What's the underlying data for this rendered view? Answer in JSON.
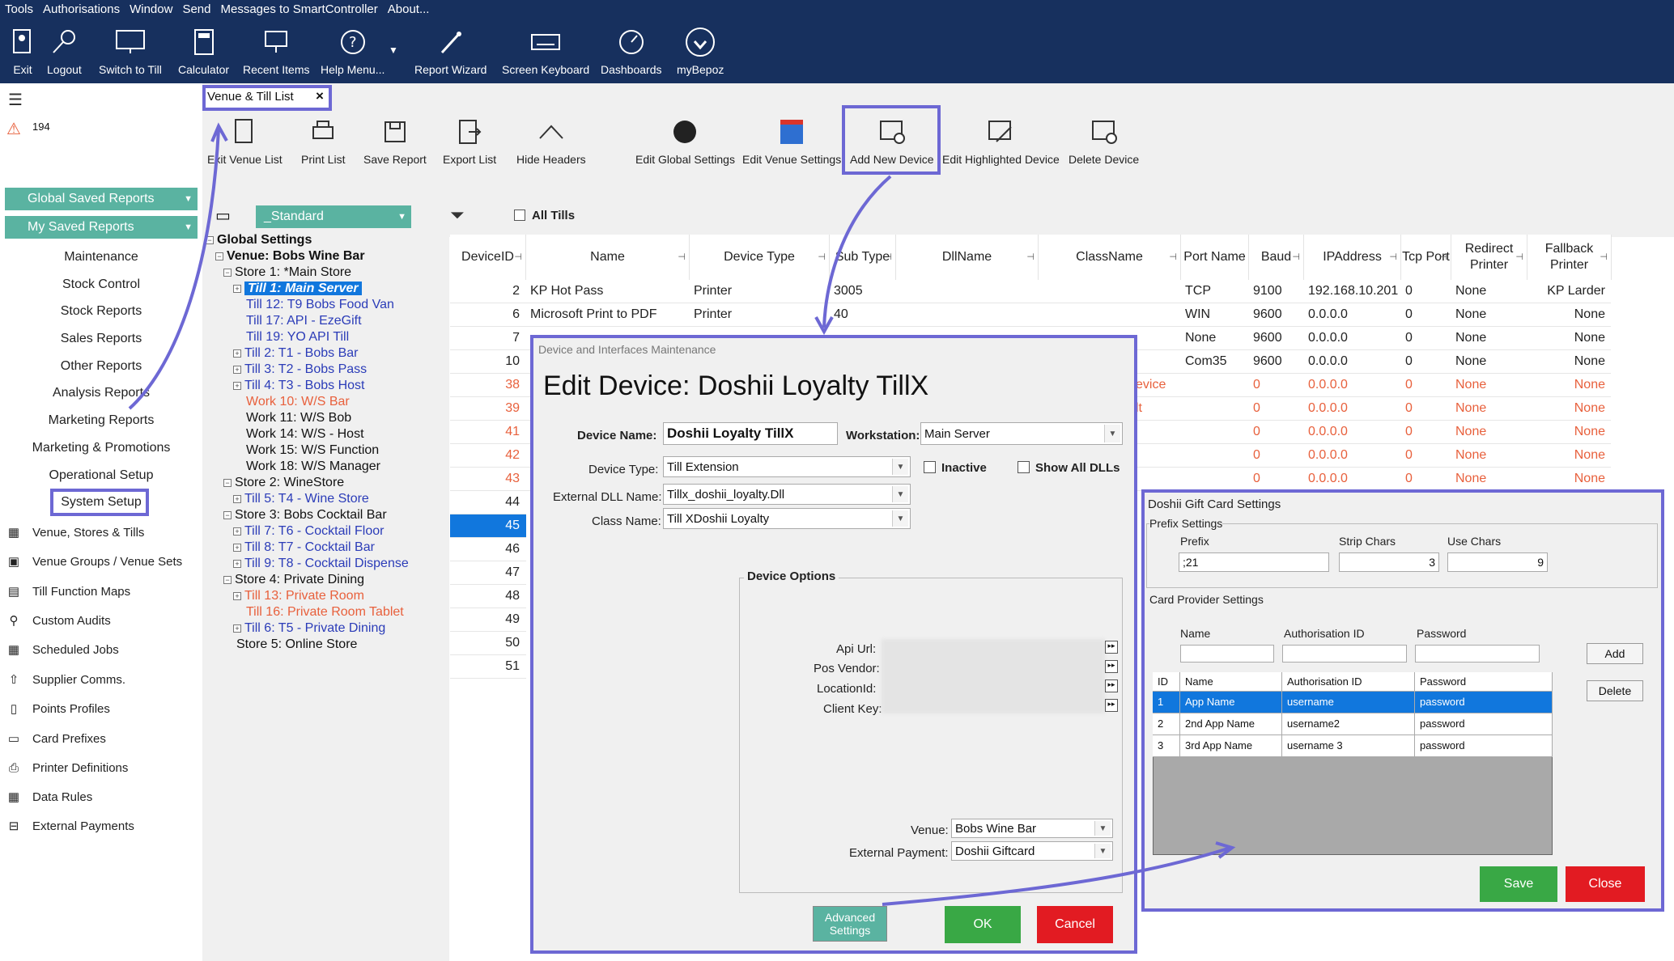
{
  "menu": [
    "Tools",
    "Authorisations",
    "Window",
    "Send",
    "Messages to SmartController",
    "About..."
  ],
  "toolbar": [
    "Exit",
    "Logout",
    "Switch to Till",
    "Calculator",
    "Recent Items",
    "Help Menu...",
    "Report Wizard",
    "Screen Keyboard",
    "Dashboards",
    "myBepoz"
  ],
  "alerts": {
    "count": "194"
  },
  "sidebar": {
    "global_reports": "Global Saved Reports",
    "my_reports": "My Saved Reports",
    "items": [
      "Maintenance",
      "Stock Control",
      "Stock Reports",
      "Sales Reports",
      "Other Reports",
      "Analysis Reports",
      "Marketing Reports",
      "Marketing & Promotions",
      "Operational Setup",
      "System Setup"
    ],
    "icon_items": [
      "Venue, Stores & Tills",
      "Venue Groups / Venue Sets",
      "Till Function Maps",
      "Custom Audits",
      "Scheduled Jobs",
      "Supplier Comms.",
      "Points Profiles",
      "Card Prefixes",
      "Printer Definitions",
      "Data Rules",
      "External Payments"
    ]
  },
  "tab": {
    "label": "Venue & Till List",
    "close": "×"
  },
  "actions": [
    "Exit Venue List",
    "Print List",
    "Save Report",
    "Export List",
    "Hide Headers",
    "Edit Global Settings",
    "Edit Venue Settings",
    "Add New Device",
    "Edit Highlighted Device",
    "Delete Device"
  ],
  "view_select": "_Standard",
  "all_tills": "All Tills",
  "tree": [
    "Global Settings",
    "Venue: Bobs Wine Bar",
    "Store 1: *Main Store",
    "Till 1: Main Server",
    "Till 12: T9 Bobs Food Van",
    "Till 17: API - EzeGift",
    "Till 19: YO API Till",
    "Till 2: T1 - Bobs Bar",
    "Till 3: T2 - Bobs Pass",
    "Till 4: T3 - Bobs Host",
    "Work 10: W/S Bar",
    "Work 11: W/S Bob",
    "Work 14: W/S - Host",
    "Work 15: W/S Function",
    "Work 18: W/S Manager",
    "Store 2: WineStore",
    "Till 5: T4 - Wine Store",
    "Store 3: Bobs Cocktail Bar",
    "Till 7: T6 - Cocktail Floor",
    "Till 8: T7 - Cocktail Bar",
    "Till 9: T8 - Cocktail Dispense",
    "Store 4: Private Dining",
    "Till 13: Private Room",
    "Till 16: Private Room Tablet",
    "Till 6: T5 - Private Dining",
    "Store 5: Online Store"
  ],
  "grid": {
    "headers": [
      "DeviceID",
      "Name",
      "Device Type",
      "Sub Type",
      "DllName",
      "ClassName",
      "Port Name",
      "Baud",
      "IPAddress",
      "Tcp Port",
      "Redirect Printer",
      "Fallback Printer"
    ],
    "rows": [
      [
        "2",
        "KP Hot Pass",
        "Printer",
        "3005",
        "",
        "",
        "TCP",
        "9100",
        "192.168.10.201",
        "0",
        "None",
        "KP Larder"
      ],
      [
        "6",
        "Microsoft Print to PDF",
        "Printer",
        "40",
        "",
        "",
        "WIN",
        "9600",
        "0.0.0.0",
        "0",
        "None",
        "None"
      ],
      [
        "7",
        "",
        "",
        "",
        "",
        "",
        "None",
        "9600",
        "0.0.0.0",
        "0",
        "None",
        "None"
      ],
      [
        "10",
        "",
        "",
        "",
        "",
        "",
        "Com35",
        "9600",
        "0.0.0.0",
        "0",
        "None",
        "None"
      ],
      [
        "38",
        "",
        "",
        "",
        "",
        "evice",
        "",
        "0",
        "0.0.0.0",
        "0",
        "None",
        "None"
      ],
      [
        "39",
        "",
        "",
        "",
        "",
        "lt",
        "",
        "0",
        "0.0.0.0",
        "0",
        "None",
        "None"
      ],
      [
        "41",
        "",
        "",
        "",
        "",
        "",
        "",
        "0",
        "0.0.0.0",
        "0",
        "None",
        "None"
      ],
      [
        "42",
        "",
        "",
        "",
        "",
        "",
        "",
        "0",
        "0.0.0.0",
        "0",
        "None",
        "None"
      ],
      [
        "43",
        "",
        "",
        "",
        "",
        "",
        "",
        "0",
        "0.0.0.0",
        "0",
        "None",
        "None"
      ],
      [
        "44",
        "",
        "",
        "",
        "",
        "",
        "",
        "",
        "",
        "",
        "",
        ""
      ],
      [
        "45",
        "",
        "",
        "",
        "",
        "",
        "",
        "",
        "",
        "",
        "",
        ""
      ],
      [
        "46",
        "",
        "",
        "",
        "",
        "",
        "",
        "",
        "",
        "",
        "",
        ""
      ],
      [
        "47",
        "",
        "",
        "",
        "",
        "",
        "",
        "",
        "",
        "",
        "",
        ""
      ],
      [
        "48",
        "",
        "",
        "",
        "",
        "",
        "",
        "",
        "",
        "",
        "",
        ""
      ],
      [
        "49",
        "",
        "",
        "",
        "",
        "",
        "",
        "",
        "",
        "",
        "",
        ""
      ],
      [
        "50",
        "",
        "",
        "",
        "",
        "",
        "",
        "",
        "",
        "",
        "",
        ""
      ],
      [
        "51",
        "",
        "",
        "",
        "",
        "",
        "",
        "",
        "",
        "",
        "",
        ""
      ]
    ]
  },
  "edit_dialog": {
    "window_title": "Device and Interfaces Maintenance",
    "title": "Edit Device: Doshii Loyalty TillX",
    "device_name_label": "Device Name:",
    "device_name": "Doshii Loyalty TillX",
    "workstation_label": "Workstation:",
    "workstation": "Main Server",
    "device_type_label": "Device Type:",
    "device_type": "Till Extension",
    "inactive": "Inactive",
    "show_all_dlls": "Show All DLLs",
    "ext_dll_label": "External DLL Name:",
    "ext_dll": "Tillx_doshii_loyalty.Dll",
    "class_label": "Class Name:",
    "class_name": "Till XDoshii Loyalty",
    "options_title": "Device Options",
    "options": [
      "Api Url:",
      "Pos Vendor:",
      "LocationId:",
      "Client Key:"
    ],
    "venue_label": "Venue:",
    "venue": "Bobs Wine Bar",
    "ext_payment_label": "External Payment:",
    "ext_payment": "Doshii Giftcard",
    "advanced": "Advanced Settings",
    "ok": "OK",
    "cancel": "Cancel"
  },
  "gift_dialog": {
    "title": "Doshii Gift Card Settings",
    "prefix_settings": "Prefix Settings",
    "prefix_label": "Prefix",
    "prefix": ";21",
    "strip_label": "Strip Chars",
    "strip": "3",
    "use_label": "Use Chars",
    "use": "9",
    "provider_settings": "Card Provider Settings",
    "name_label": "Name",
    "auth_label": "Authorisation ID",
    "password_label": "Password",
    "add": "Add",
    "delete": "Delete",
    "table_headers": [
      "ID",
      "Name",
      "Authorisation ID",
      "Password"
    ],
    "rows": [
      [
        "1",
        "App Name",
        "username",
        "password"
      ],
      [
        "2",
        "2nd App Name",
        "username2",
        "password"
      ],
      [
        "3",
        "3rd App Name",
        "username 3",
        "password"
      ]
    ],
    "save": "Save",
    "close": "Close"
  },
  "colors": {
    "topbar": "#17305e",
    "accent": "#5ab3a1",
    "highlight": "#6d68d4",
    "ok": "#39a845",
    "cancel": "#e21b22",
    "selected": "#1177dd"
  }
}
